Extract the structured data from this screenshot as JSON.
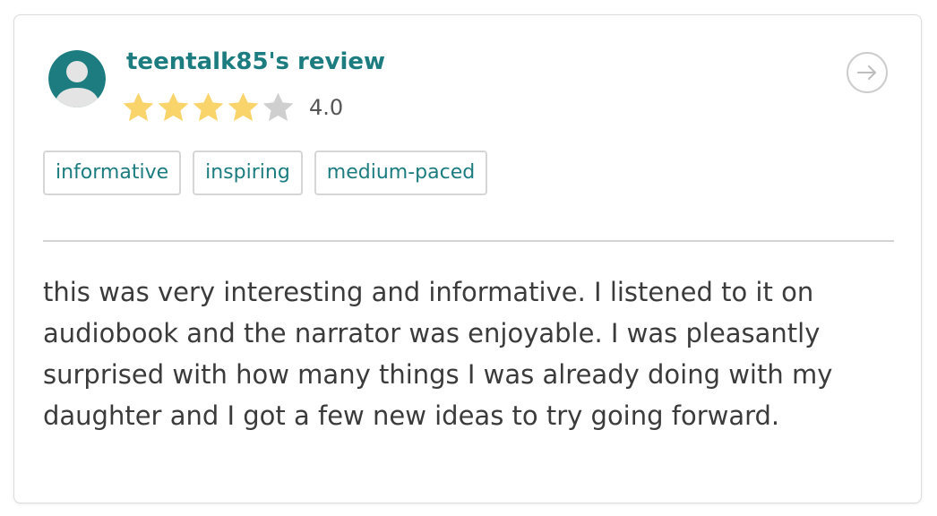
{
  "review": {
    "title": "teentalk85's review",
    "rating": 4,
    "rating_max": 5,
    "rating_label": "4.0",
    "tags": [
      "informative",
      "inspiring",
      "medium-paced"
    ],
    "body": "this was very interesting and informative. I listened to it on audiobook and the narrator was enjoyable. I was pleasantly surprised with how many things I was already doing with my daughter and I got a few new ideas to try going forward."
  },
  "colors": {
    "accent": "#1c7c80",
    "star_filled": "#f9d46b",
    "star_empty": "#cfcfcf",
    "avatar_bg": "#1c7c80",
    "avatar_figure": "#e4e4e4"
  },
  "icons": {
    "avatar": "user-avatar-icon",
    "star": "star-icon",
    "arrow": "arrow-right-circle-icon"
  }
}
